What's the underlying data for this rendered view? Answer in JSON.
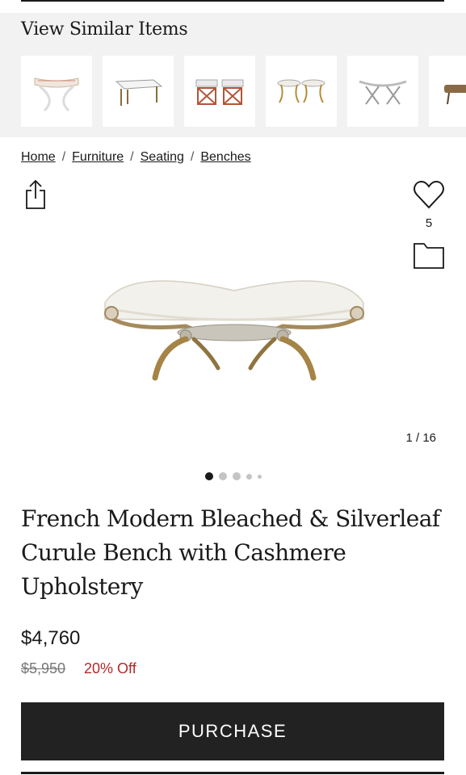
{
  "similar": {
    "title": "View Similar Items",
    "thumbnails": [
      {
        "icon": "curule-stool-thumbnail"
      },
      {
        "icon": "upholstered-bench-thumbnail"
      },
      {
        "icon": "pair-of-x-stools-thumbnail"
      },
      {
        "icon": "pair-of-brass-stools-thumbnail"
      },
      {
        "icon": "glass-x-bench-thumbnail"
      },
      {
        "icon": "leather-bench-thumbnail"
      }
    ]
  },
  "breadcrumb": [
    "Home",
    "Furniture",
    "Seating",
    "Benches"
  ],
  "actions": {
    "share_icon": "share-icon",
    "favorite_icon": "heart-icon",
    "favorite_count": "5",
    "folder_icon": "folder-icon"
  },
  "gallery": {
    "counter": "1 / 16",
    "active_dot": 1
  },
  "product": {
    "title": "French Modern Bleached & Silverleaf Curule Bench with Cashmere Upholstery",
    "price": "$4,760",
    "original_price": "$5,950",
    "discount": "20% Off"
  },
  "purchase_label": "PURCHASE",
  "colors": {
    "button": "#222222",
    "discount": "#b02a2a",
    "panel": "#f2f2f2"
  }
}
